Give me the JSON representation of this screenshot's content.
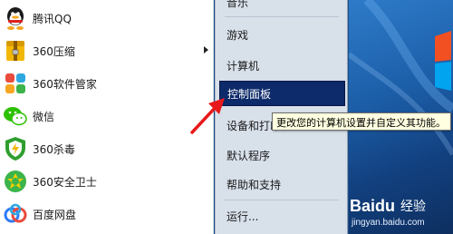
{
  "programs": [
    {
      "label": "腾讯QQ",
      "icon": "qq-icon",
      "has_submenu": false
    },
    {
      "label": "360压缩",
      "icon": "archive-icon",
      "has_submenu": true
    },
    {
      "label": "360软件管家",
      "icon": "software-manager-icon",
      "has_submenu": false
    },
    {
      "label": "微信",
      "icon": "wechat-icon",
      "has_submenu": false
    },
    {
      "label": "360杀毒",
      "icon": "antivirus-shield-icon",
      "has_submenu": false
    },
    {
      "label": "360安全卫士",
      "icon": "security-guard-icon",
      "has_submenu": false
    },
    {
      "label": "百度网盘",
      "icon": "cloud-drive-icon",
      "has_submenu": false
    }
  ],
  "right_menu": {
    "items": [
      {
        "label": "音乐",
        "selected": false
      },
      {
        "label": "游戏",
        "selected": false
      },
      {
        "label": "计算机",
        "selected": false
      },
      {
        "label": "控制面板",
        "selected": true
      },
      {
        "label": "设备和打印机",
        "selected": false
      },
      {
        "label": "默认程序",
        "selected": false
      },
      {
        "label": "帮助和支持",
        "selected": false
      },
      {
        "label": "运行...",
        "selected": false
      }
    ]
  },
  "tooltip": {
    "text": "更改您的计算机设置并自定义其功能。"
  },
  "watermark": {
    "brand": "Baidu",
    "brand_cn": "经验",
    "url": "jingyan.baidu.com"
  },
  "colors": {
    "selection": "#0d2a6a",
    "right_pane": "#d8e0ea",
    "tooltip_bg": "#ffffe1",
    "arrow": "#e8191b"
  }
}
